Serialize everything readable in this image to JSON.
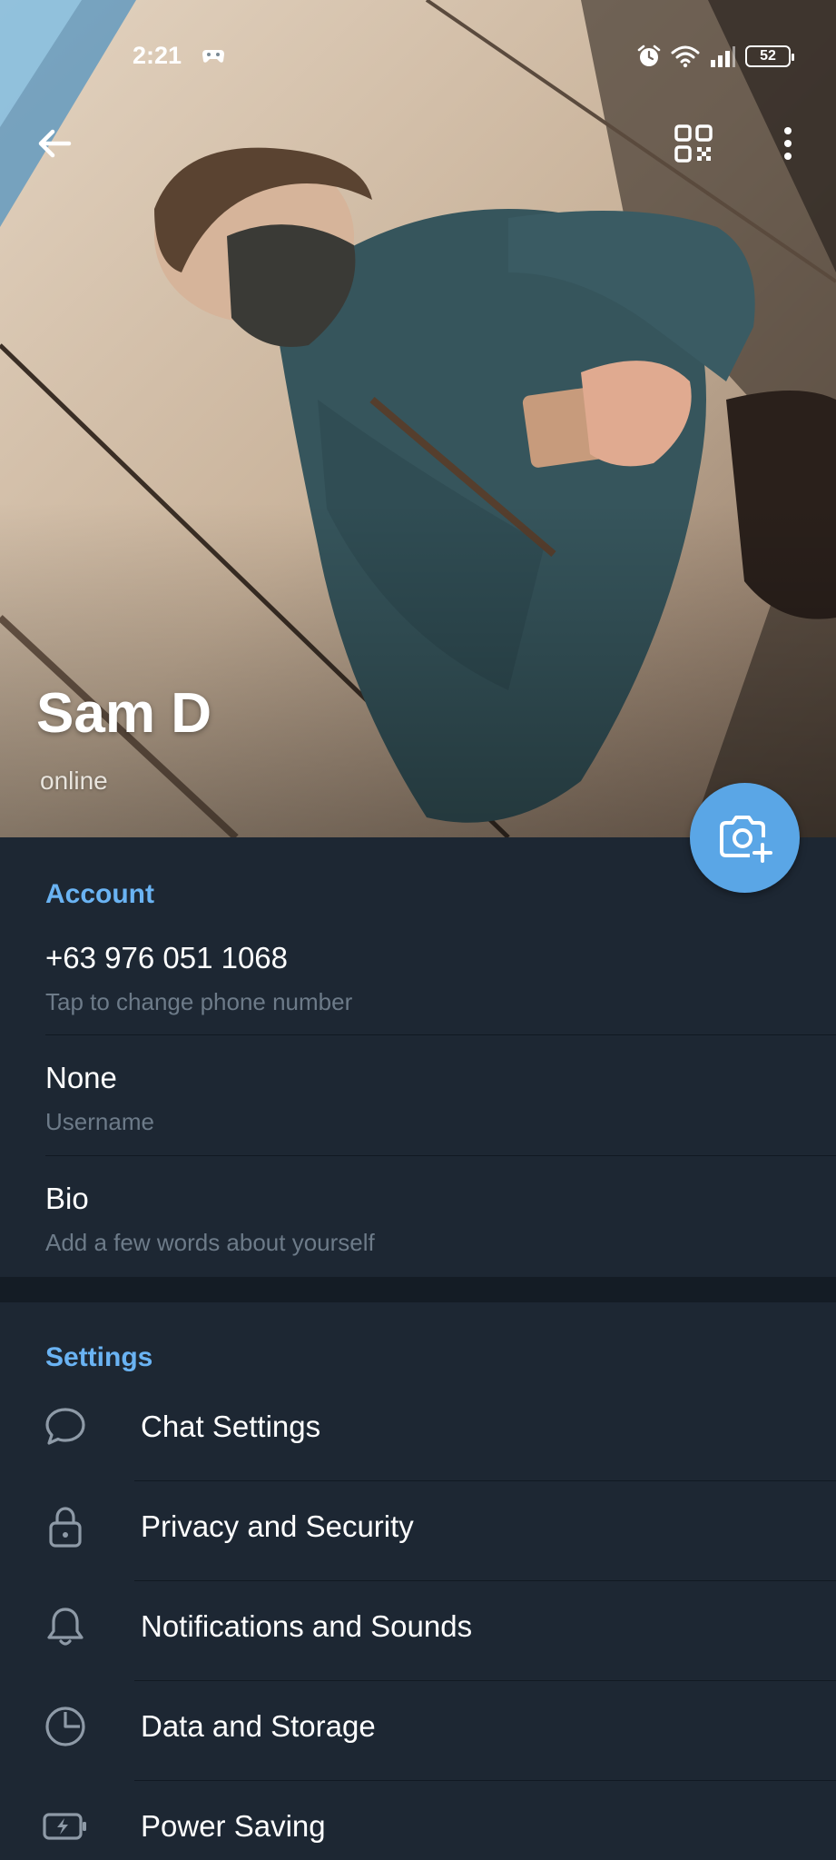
{
  "status_bar": {
    "time": "2:21",
    "battery": "52"
  },
  "profile": {
    "name": "Sam D",
    "status": "online"
  },
  "account": {
    "section_title": "Account",
    "phone": "+63 976 051 1068",
    "phone_hint": "Tap to change phone number",
    "username": "None",
    "username_hint": "Username",
    "bio": "Bio",
    "bio_hint": "Add a few words about yourself"
  },
  "settings": {
    "section_title": "Settings",
    "items": [
      {
        "label": "Chat Settings",
        "icon": "chat-bubble-icon"
      },
      {
        "label": "Privacy and Security",
        "icon": "lock-icon"
      },
      {
        "label": "Notifications and Sounds",
        "icon": "bell-icon"
      },
      {
        "label": "Data and Storage",
        "icon": "pie-chart-icon"
      },
      {
        "label": "Power Saving",
        "icon": "battery-bolt-icon"
      }
    ]
  },
  "colors": {
    "background": "#1d2733",
    "accent": "#6ab3f3",
    "fab": "#5aa6e6",
    "hint_text": "#6d7b89"
  }
}
